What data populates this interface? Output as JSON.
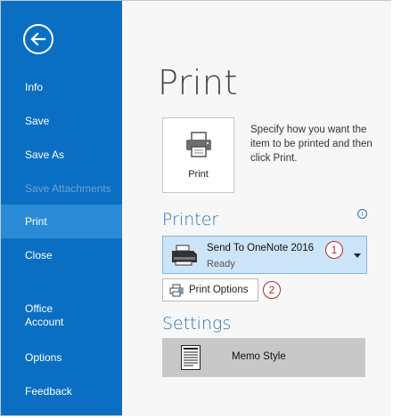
{
  "sidebar": {
    "back_icon": "back-arrow-icon",
    "items": [
      {
        "label": "Info",
        "state": "normal"
      },
      {
        "label": "Save",
        "state": "normal"
      },
      {
        "label": "Save As",
        "state": "normal"
      },
      {
        "label": "Save Attachments",
        "state": "disabled"
      },
      {
        "label": "Print",
        "state": "active"
      },
      {
        "label": "Close",
        "state": "normal"
      },
      {
        "label": "Office\nAccount",
        "state": "normal"
      },
      {
        "label": "Options",
        "state": "normal"
      },
      {
        "label": "Feedback",
        "state": "normal"
      }
    ]
  },
  "main": {
    "title": "Print",
    "print_button": {
      "label": "Print",
      "icon": "printer-icon"
    },
    "print_description": "Specify how you want the item to be printed and then click Print.",
    "printer_section": {
      "title": "Printer",
      "info_icon": "info-icon",
      "info_glyph": "i",
      "selected_printer": "Send To OneNote 2016",
      "status": "Ready",
      "badge": "1"
    },
    "print_options": {
      "label": "Print Options",
      "badge": "2"
    },
    "settings_section": {
      "title": "Settings",
      "style_label": "Memo Style"
    }
  },
  "colors": {
    "sidebar_bg": "#0a6fc2",
    "sidebar_active": "#2b8ad6",
    "section_title": "#2b72b7",
    "printer_select_bg": "#cce4f7",
    "badge": "#b02a2a"
  }
}
